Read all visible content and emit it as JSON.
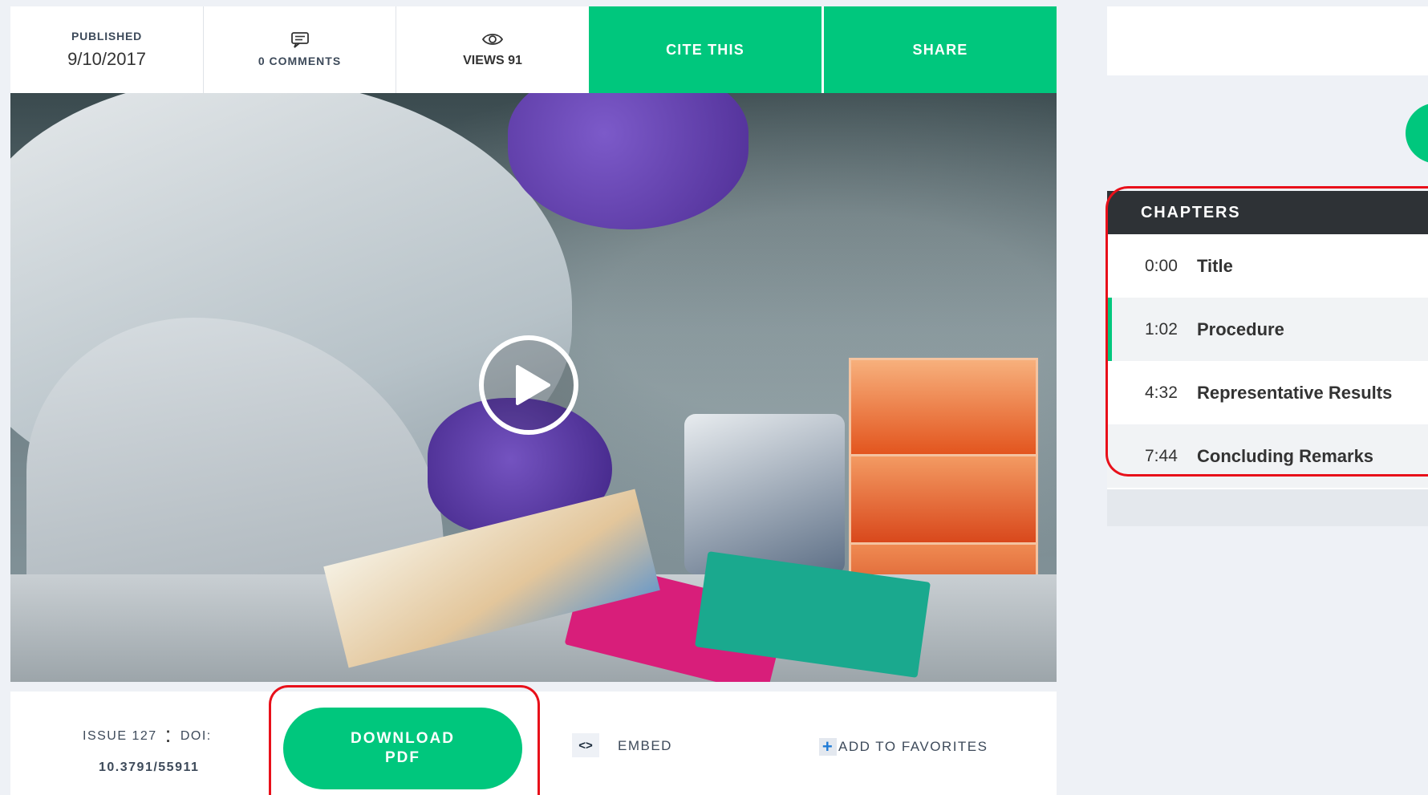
{
  "stats": {
    "published_label": "PUBLISHED",
    "published_date": "9/10/2017",
    "comments_label": "0 COMMENTS",
    "views_label": "VIEWS 91"
  },
  "actions": {
    "cite_label": "CITE THIS",
    "share_label": "SHARE",
    "download_line1": "DOWNLOAD",
    "download_line2": "PDF",
    "embed_icon_glyph": "<>",
    "embed_label": "EMBED",
    "favorites_label": "ADD TO FAVORITES"
  },
  "article": {
    "issue_label": "ISSUE 127",
    "colon": ":",
    "doi_label": "DOI:",
    "doi_value": "10.3791/55911"
  },
  "chapters": {
    "title": "CHAPTERS",
    "items": [
      {
        "time": "0:00",
        "title": "Title"
      },
      {
        "time": "1:02",
        "title": "Procedure"
      },
      {
        "time": "4:32",
        "title": "Representative Results"
      },
      {
        "time": "7:44",
        "title": "Concluding Remarks"
      }
    ]
  },
  "icons": {
    "comments": "comment-icon",
    "views": "eye-icon",
    "play": "play-icon",
    "embed": "code-icon",
    "favorites": "plus-icon"
  },
  "colors": {
    "accent_green": "#00c77d",
    "highlight_red": "#e8101a",
    "chapters_header": "#2e3236"
  }
}
